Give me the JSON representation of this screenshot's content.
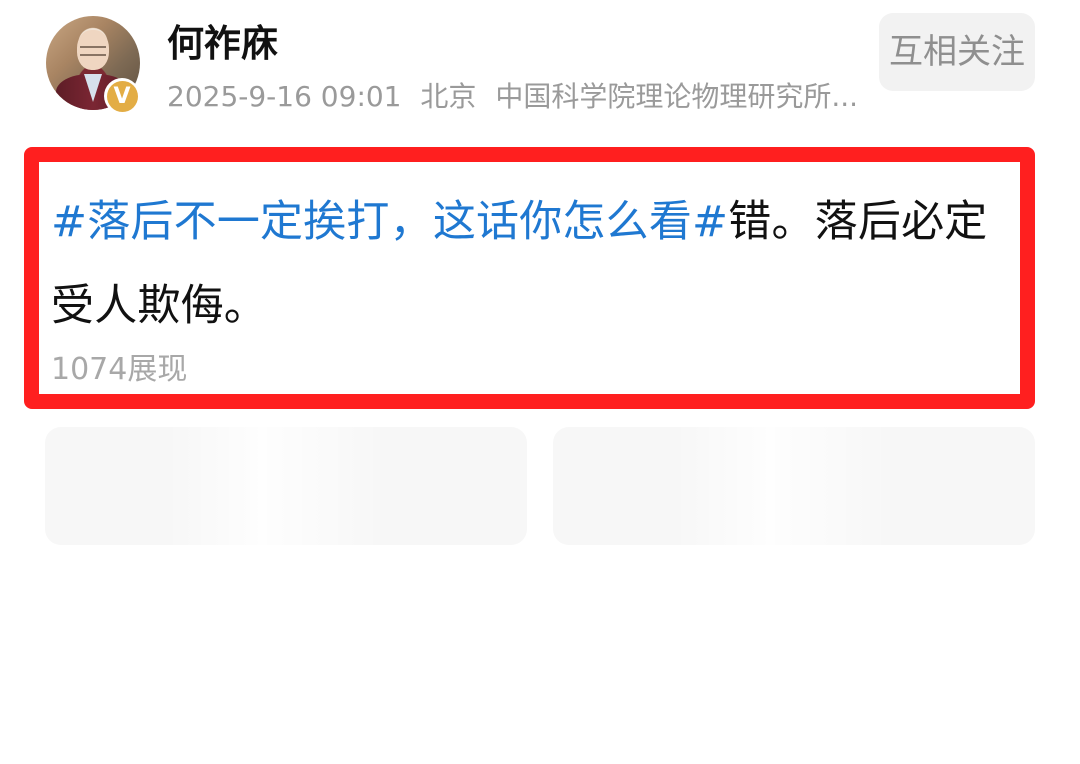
{
  "header": {
    "username": "何祚庥",
    "timestamp": "2025-9-16 09:01",
    "location": "北京",
    "institution": "中国科学院理论物理研究所...",
    "follow_label": "互相关注",
    "verified_badge": "V"
  },
  "post": {
    "topic": "#落后不一定挨打，这话你怎么看#",
    "body": "错。落后必定受人欺侮。",
    "impressions": "1074展现"
  },
  "colors": {
    "highlight_border": "#ff1f1f",
    "topic_link": "#1f78d1",
    "verified_badge": "#e3ad45"
  },
  "icons": {
    "verified": "verified-badge-icon"
  }
}
